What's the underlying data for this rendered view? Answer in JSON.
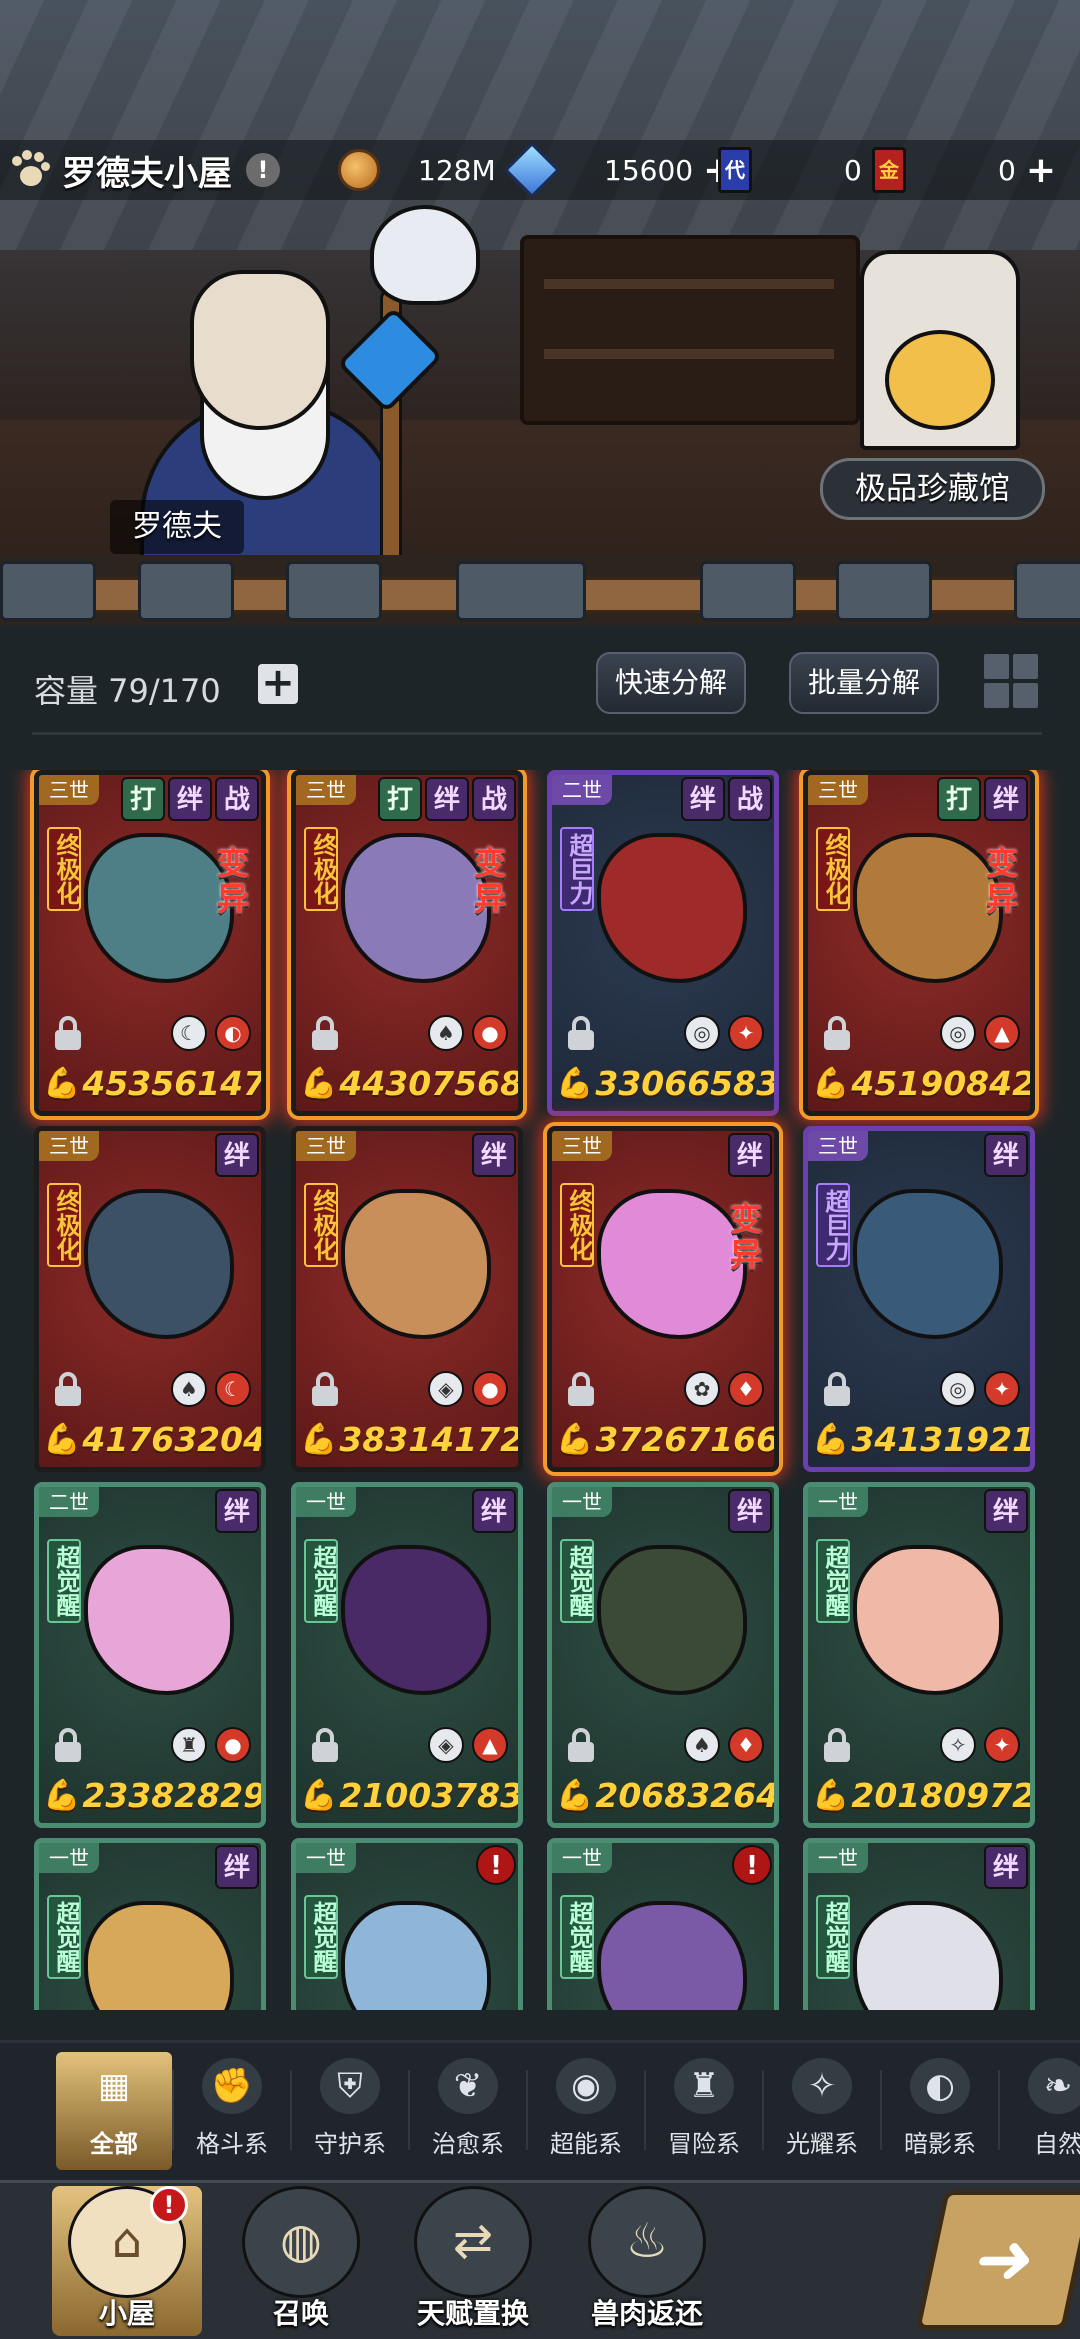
{
  "header": {
    "title": "罗德夫小屋",
    "warning_symbol": "!",
    "gold": "128M",
    "crystals": "15600",
    "ticket_dai_label": "代",
    "ticket_dai": "0",
    "ticket_jin_label": "金",
    "ticket_jin": "0",
    "plus": "+"
  },
  "scene": {
    "npc_name": "罗德夫",
    "museum_button": "极品珍藏馆"
  },
  "inventory": {
    "capacity": "容量 79/170",
    "add": "+",
    "quick_decompose": "快速分解",
    "batch_decompose": "批量分解"
  },
  "cards": [
    {
      "gen": "三世",
      "style": "red",
      "glow": true,
      "badges": [
        {
          "t": "打",
          "c": "b-green"
        },
        {
          "t": "绊",
          "c": "b-purple"
        },
        {
          "t": "战",
          "c": "b-purple"
        }
      ],
      "tag": "终极化",
      "tag_style": "t-red",
      "mutation": "变异",
      "power": "45356147",
      "elems": [
        "☾",
        "◐"
      ],
      "body": "#4f7f86"
    },
    {
      "gen": "三世",
      "style": "red",
      "glow": true,
      "badges": [
        {
          "t": "打",
          "c": "b-green"
        },
        {
          "t": "绊",
          "c": "b-purple"
        },
        {
          "t": "战",
          "c": "b-purple"
        }
      ],
      "tag": "终极化",
      "tag_style": "t-red",
      "mutation": "变异",
      "power": "44307568",
      "elems": [
        "♠",
        "●"
      ],
      "body": "#8a7ab8"
    },
    {
      "gen": "二世",
      "style": "purple",
      "glow": false,
      "badges": [
        {
          "t": "绊",
          "c": "b-purple"
        },
        {
          "t": "战",
          "c": "b-purple"
        }
      ],
      "tag": "超巨力",
      "tag_style": "t-purple",
      "mutation": "",
      "power": "33066583",
      "elems": [
        "◎",
        "✦"
      ],
      "body": "#9e2a2a"
    },
    {
      "gen": "三世",
      "style": "red",
      "glow": true,
      "badges": [
        {
          "t": "打",
          "c": "b-green"
        },
        {
          "t": "绊",
          "c": "b-purple"
        }
      ],
      "tag": "终极化",
      "tag_style": "t-red",
      "mutation": "变异",
      "power": "45190842",
      "elems": [
        "◎",
        "▲"
      ],
      "body": "#b27a3a"
    },
    {
      "gen": "三世",
      "style": "red",
      "glow": false,
      "badges": [
        {
          "t": "绊",
          "c": "b-purple"
        }
      ],
      "tag": "终极化",
      "tag_style": "t-red",
      "mutation": "",
      "power": "41763204",
      "elems": [
        "♠",
        "☾"
      ],
      "body": "#3c5066"
    },
    {
      "gen": "三世",
      "style": "red",
      "glow": false,
      "badges": [
        {
          "t": "绊",
          "c": "b-purple"
        }
      ],
      "tag": "终极化",
      "tag_style": "t-red",
      "mutation": "",
      "power": "38314172",
      "elems": [
        "◈",
        "●"
      ],
      "body": "#c98f5a"
    },
    {
      "gen": "三世",
      "style": "red",
      "glow": true,
      "badges": [
        {
          "t": "绊",
          "c": "b-purple"
        }
      ],
      "tag": "终极化",
      "tag_style": "t-red",
      "mutation": "变异",
      "power": "37267166",
      "elems": [
        "✿",
        "♦"
      ],
      "body": "#e08ad8"
    },
    {
      "gen": "三世",
      "style": "purple",
      "glow": false,
      "badges": [
        {
          "t": "绊",
          "c": "b-purple"
        }
      ],
      "tag": "超巨力",
      "tag_style": "t-purple",
      "mutation": "",
      "power": "34131921",
      "elems": [
        "◎",
        "✦"
      ],
      "body": "#3a5a7a"
    },
    {
      "gen": "二世",
      "style": "green",
      "glow": false,
      "badges": [
        {
          "t": "绊",
          "c": "b-purple"
        }
      ],
      "tag": "超觉醒",
      "tag_style": "t-green",
      "mutation": "",
      "power": "23382829",
      "elems": [
        "♜",
        "●"
      ],
      "body": "#e8a6d8"
    },
    {
      "gen": "一世",
      "style": "green",
      "glow": false,
      "badges": [
        {
          "t": "绊",
          "c": "b-purple"
        }
      ],
      "tag": "超觉醒",
      "tag_style": "t-green",
      "mutation": "",
      "power": "21003783",
      "elems": [
        "◈",
        "▲"
      ],
      "body": "#4a2a66"
    },
    {
      "gen": "一世",
      "style": "green",
      "glow": false,
      "badges": [
        {
          "t": "绊",
          "c": "b-purple"
        }
      ],
      "tag": "超觉醒",
      "tag_style": "t-green",
      "mutation": "",
      "power": "20683264",
      "elems": [
        "♠",
        "♦"
      ],
      "body": "#3a4a36"
    },
    {
      "gen": "一世",
      "style": "green",
      "glow": false,
      "badges": [
        {
          "t": "绊",
          "c": "b-purple"
        }
      ],
      "tag": "超觉醒",
      "tag_style": "t-green",
      "mutation": "",
      "power": "20180972",
      "elems": [
        "✧",
        "✦"
      ],
      "body": "#f0b8a6"
    },
    {
      "gen": "一世",
      "style": "green",
      "glow": false,
      "badges": [
        {
          "t": "绊",
          "c": "b-purple"
        }
      ],
      "tag": "超觉醒",
      "tag_style": "t-green",
      "mutation": "",
      "power": "",
      "elems": [],
      "body": "#d8a85a"
    },
    {
      "gen": "一世",
      "style": "green",
      "glow": false,
      "badges": [
        {
          "t": "!",
          "c": "b-alert"
        }
      ],
      "tag": "超觉醒",
      "tag_style": "t-green",
      "mutation": "",
      "power": "",
      "elems": [],
      "body": "#8fb6d8"
    },
    {
      "gen": "一世",
      "style": "green",
      "glow": false,
      "badges": [
        {
          "t": "!",
          "c": "b-alert"
        }
      ],
      "tag": "超觉醒",
      "tag_style": "t-green",
      "mutation": "",
      "power": "",
      "elems": [],
      "body": "#7a5aa6"
    },
    {
      "gen": "一世",
      "style": "green",
      "glow": false,
      "badges": [
        {
          "t": "绊",
          "c": "b-purple"
        }
      ],
      "tag": "超觉醒",
      "tag_style": "t-green",
      "mutation": "",
      "power": "",
      "elems": [],
      "body": "#e0e0e8"
    }
  ],
  "categories": [
    {
      "label": "全部",
      "icon": "▦",
      "name": "all"
    },
    {
      "label": "格斗系",
      "icon": "✊",
      "name": "fighting"
    },
    {
      "label": "守护系",
      "icon": "⛨",
      "name": "guardian"
    },
    {
      "label": "治愈系",
      "icon": "❦",
      "name": "healing"
    },
    {
      "label": "超能系",
      "icon": "◉",
      "name": "psychic"
    },
    {
      "label": "冒险系",
      "icon": "♜",
      "name": "adventure"
    },
    {
      "label": "光耀系",
      "icon": "✧",
      "name": "light"
    },
    {
      "label": "暗影系",
      "icon": "◐",
      "name": "shadow"
    },
    {
      "label": "自然",
      "icon": "❧",
      "name": "nature"
    }
  ],
  "nav": [
    {
      "label": "小屋",
      "icon": "⌂",
      "name": "house"
    },
    {
      "label": "召唤",
      "icon": "◍",
      "name": "summon"
    },
    {
      "label": "天赋置换",
      "icon": "⇄",
      "name": "talent-swap"
    },
    {
      "label": "兽肉返还",
      "icon": "♨",
      "name": "meat-return"
    }
  ],
  "notif": "!",
  "back": "➜"
}
